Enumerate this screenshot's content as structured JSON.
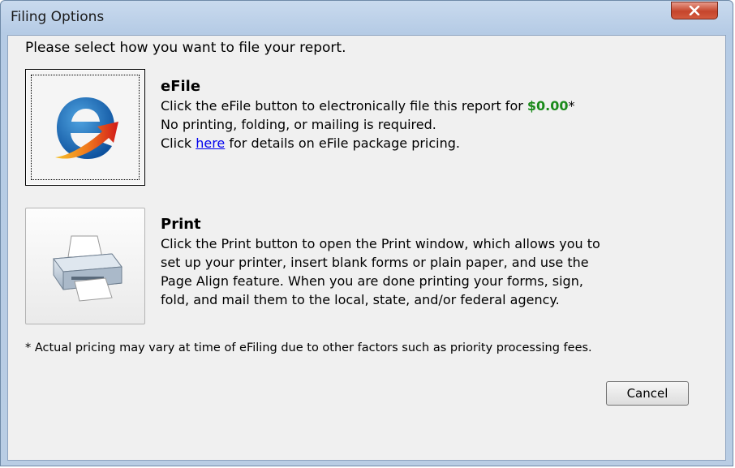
{
  "window": {
    "title": "Filing Options"
  },
  "instruction": "Please select how you want to file your report.",
  "efile": {
    "heading": "eFile",
    "line1_prefix": "Click the eFile button to electronically file this report for ",
    "price": "$0.00",
    "price_suffix": "*",
    "line2": "No printing, folding, or mailing is required.",
    "line3_prefix": "Click ",
    "link_text": "here",
    "line3_suffix": " for details on eFile package pricing."
  },
  "print": {
    "heading": "Print",
    "lines": [
      "Click the Print button to open the Print window, which allows you to",
      "set up your printer, insert blank forms or plain paper, and use the",
      "Page Align feature. When you are done printing your forms, sign,",
      "fold, and mail them to the local, state, and/or federal agency."
    ]
  },
  "footnote": "* Actual pricing may vary at time of eFiling due to other factors such as priority processing fees.",
  "buttons": {
    "cancel": "Cancel"
  },
  "icons": {
    "close": "close-icon",
    "efile": "efile-icon",
    "print": "printer-icon"
  },
  "colors": {
    "price": "#1a8a1a",
    "link": "#0000ee",
    "close_button": "#c5452c"
  }
}
